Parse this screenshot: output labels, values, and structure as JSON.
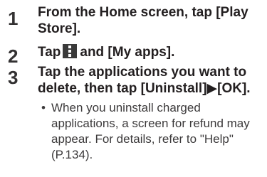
{
  "steps": [
    {
      "number": "1",
      "line1": "From the Home screen, tap [Play",
      "line2": "Store]."
    },
    {
      "number": "2",
      "before_icon": "Tap",
      "icon": "menu-kebab-icon",
      "after_icon": "and [My apps]."
    },
    {
      "number": "3",
      "line1": "Tap the applications you want to",
      "line2": "delete, then tap [Uninstall]▶[OK]."
    }
  ],
  "note": {
    "bullet": "•",
    "lines": [
      "When you uninstall charged",
      "applications, a screen for refund may",
      "appear. For details, refer to \"Help\"",
      "(P.134)."
    ]
  }
}
